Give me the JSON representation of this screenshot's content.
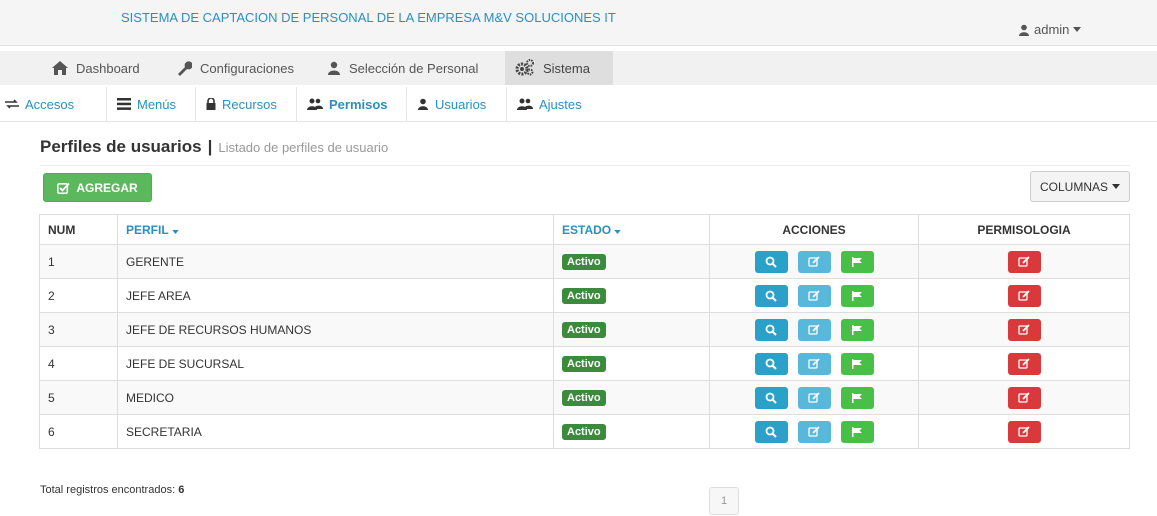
{
  "header": {
    "title": "SISTEMA DE CAPTACION DE PERSONAL DE LA EMPRESA M&V SOLUCIONES IT",
    "user": "admin"
  },
  "main_nav": [
    {
      "label": "Dashboard",
      "icon": "home-icon"
    },
    {
      "label": "Configuraciones",
      "icon": "wrench-icon"
    },
    {
      "label": "Selección de Personal",
      "icon": "user-icon"
    },
    {
      "label": "Sistema",
      "icon": "cogs-icon",
      "active": true
    }
  ],
  "sub_nav": [
    {
      "label": "Accesos",
      "icon": "exchange-icon"
    },
    {
      "label": "Menús",
      "icon": "list-icon"
    },
    {
      "label": "Recursos",
      "icon": "lock-icon"
    },
    {
      "label": "Permisos",
      "icon": "users-icon",
      "active": true
    },
    {
      "label": "Usuarios",
      "icon": "user-icon"
    },
    {
      "label": "Ajustes",
      "icon": "users-icon"
    }
  ],
  "page": {
    "title": "Perfiles de usuarios",
    "separator": "|",
    "subtitle": "Listado de perfiles de usuario",
    "add_button": "AGREGAR",
    "columns_button": "COLUMNAS"
  },
  "table": {
    "headers": {
      "num": "NUM",
      "perfil": "PERFIL",
      "estado": "ESTADO",
      "acciones": "ACCIONES",
      "permisologia": "PERMISOLOGIA"
    },
    "rows": [
      {
        "num": "1",
        "perfil": "GERENTE",
        "estado": "Activo"
      },
      {
        "num": "2",
        "perfil": "JEFE AREA",
        "estado": "Activo"
      },
      {
        "num": "3",
        "perfil": "JEFE DE RECURSOS HUMANOS",
        "estado": "Activo"
      },
      {
        "num": "4",
        "perfil": "JEFE DE SUCURSAL",
        "estado": "Activo"
      },
      {
        "num": "5",
        "perfil": "MEDICO",
        "estado": "Activo"
      },
      {
        "num": "6",
        "perfil": "SECRETARIA",
        "estado": "Activo"
      }
    ]
  },
  "footer": {
    "total_label": "Total registros encontrados:",
    "total_count": "6",
    "page": "1"
  },
  "colors": {
    "accent": "#2a8fc4",
    "success": "#5cb85c",
    "danger": "#d9393b",
    "info": "#2ba1c9"
  }
}
